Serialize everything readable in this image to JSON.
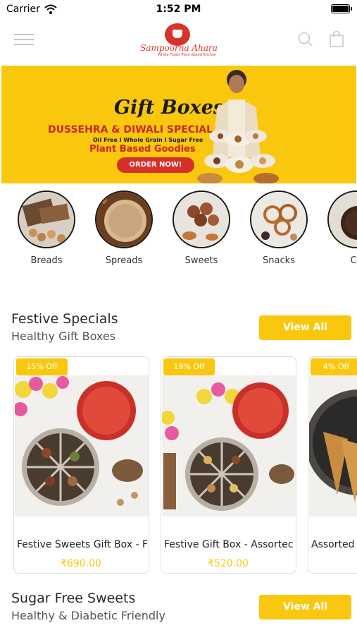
{
  "status_bar": {
    "carrier": "Carrier",
    "time": "1:52 PM"
  },
  "header": {
    "brand_name": "Sampoorna Ahara",
    "brand_tagline": "Whole Foods Plant Based Kitchen",
    "icons": [
      "menu-icon",
      "search-icon",
      "shopping-bag-icon"
    ]
  },
  "banner": {
    "title": "Gift Boxes",
    "line1": "DUSSEHRA & DIWALI SPECIAL",
    "line2": "Oil Free I Whole Grain I Sugar Free",
    "line3": "Plant Based Goodies",
    "cta": "ORDER NOW!"
  },
  "categories": [
    {
      "label": "Breads"
    },
    {
      "label": "Spreads"
    },
    {
      "label": "Sweets"
    },
    {
      "label": "Snacks"
    },
    {
      "label": "Ca"
    }
  ],
  "festive": {
    "title": "Festive Specials",
    "subtitle": "Healthy Gift Boxes",
    "view_all": "View All",
    "products": [
      {
        "badge": "15% Off",
        "name": "Festive Sweets Gift Box - F",
        "price": "₹690.00"
      },
      {
        "badge": "19% Off",
        "name": "Festive Gift Box - Assortec",
        "price": "₹520.00"
      },
      {
        "badge": "4% Off",
        "name": "Assorted",
        "price": "₹"
      }
    ]
  },
  "sugar_free": {
    "title": "Sugar Free Sweets",
    "subtitle": "Healthy & Diabetic Friendly",
    "view_all": "View All"
  },
  "colors": {
    "accent": "#f9c80e",
    "brand_red": "#d8322b"
  }
}
